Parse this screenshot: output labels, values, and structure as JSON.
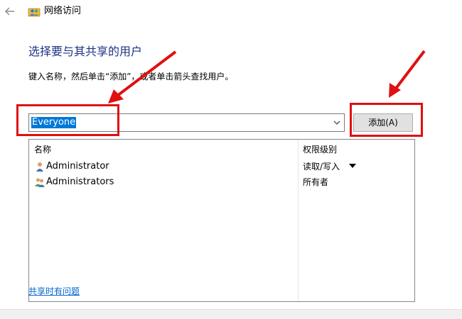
{
  "window": {
    "title": "网络访问",
    "back_icon": "arrow-left-icon",
    "app_icon": "network-users-icon"
  },
  "main": {
    "heading": "选择要与其共享的用户",
    "instruction": "键入名称，然后单击“添加”，或者单击箭头查找用户。",
    "combo": {
      "value": "Everyone",
      "arrow_icon": "chevron-down-icon"
    },
    "add_button": "添加(A)",
    "list": {
      "headers": {
        "name": "名称",
        "permission": "权限级别"
      },
      "rows": [
        {
          "name": "Administrator",
          "permission": "读取/写入",
          "icon": "user-icon",
          "has_dropdown": true
        },
        {
          "name": "Administrators",
          "permission": "所有者",
          "icon": "user-group-icon",
          "has_dropdown": false
        }
      ]
    },
    "help_link": "共享时有问题"
  },
  "colors": {
    "heading": "#1e3287",
    "selection": "#0078d7",
    "link": "#0066cc",
    "annotation": "#e01010"
  }
}
